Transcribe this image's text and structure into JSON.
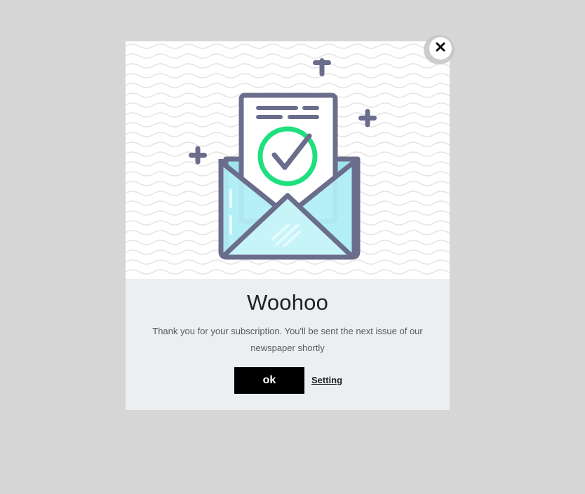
{
  "modal": {
    "title": "Woohoo",
    "message": "Thank you for your subscription. You'll be sent the next issue of our newspaper shortly",
    "ok_label": "ok",
    "setting_label": "Setting"
  },
  "icons": {
    "close": "close-icon",
    "illustration": "envelope-checkmark-illustration",
    "sparkle": "plus-sparkle-icon"
  },
  "colors": {
    "backdrop": "#d6d6d6",
    "modal_bg": "#eceff1",
    "outline": "#6b6d8c",
    "check_green": "#1ee07f",
    "envelope_fill": "#b2eef5",
    "ok_bg": "#000000"
  }
}
